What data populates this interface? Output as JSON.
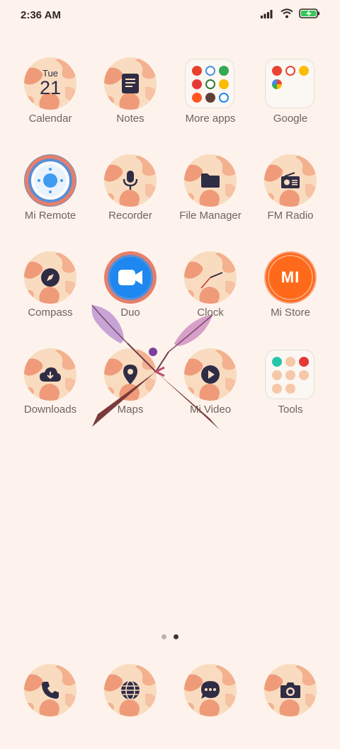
{
  "status": {
    "time": "2:36 AM",
    "icons": [
      "signal-icon",
      "wifi-icon",
      "battery-charging-icon"
    ],
    "battery_color": "#34c759"
  },
  "apps": [
    {
      "label": "Calendar",
      "icon": "calendar-icon",
      "day": "Tue",
      "date": "21"
    },
    {
      "label": "Notes",
      "icon": "notes-icon"
    },
    {
      "label": "More apps",
      "icon": "folder-icon"
    },
    {
      "label": "Google",
      "icon": "folder-icon"
    },
    {
      "label": "Mi Remote",
      "icon": "remote-icon"
    },
    {
      "label": "Recorder",
      "icon": "microphone-icon"
    },
    {
      "label": "File Manager",
      "icon": "folder-file-icon"
    },
    {
      "label": "FM Radio",
      "icon": "radio-icon"
    },
    {
      "label": "Compass",
      "icon": "compass-icon"
    },
    {
      "label": "Duo",
      "icon": "video-camera-icon"
    },
    {
      "label": "Clock",
      "icon": "clock-icon"
    },
    {
      "label": "Mi Store",
      "icon": "mi-logo-icon",
      "logo_text": "MI"
    },
    {
      "label": "Downloads",
      "icon": "download-cloud-icon"
    },
    {
      "label": "Maps",
      "icon": "map-pin-icon"
    },
    {
      "label": "Mi Video",
      "icon": "play-icon"
    },
    {
      "label": "Tools",
      "icon": "folder-icon"
    }
  ],
  "dock": [
    {
      "name": "phone",
      "icon": "phone-icon"
    },
    {
      "name": "browser",
      "icon": "globe-icon"
    },
    {
      "name": "messages",
      "icon": "message-icon"
    },
    {
      "name": "camera",
      "icon": "camera-icon"
    }
  ],
  "page_indicator": {
    "count": 2,
    "active": 2
  },
  "colors": {
    "background": "#fdf3ec",
    "icon_base": "#f9dcc0",
    "icon_swirl": "#ef9b7a",
    "glyph": "#2f2d45",
    "label": "#6e6460",
    "duo_blue": "#1e88f0",
    "mi_orange": "#ff6a1a"
  }
}
